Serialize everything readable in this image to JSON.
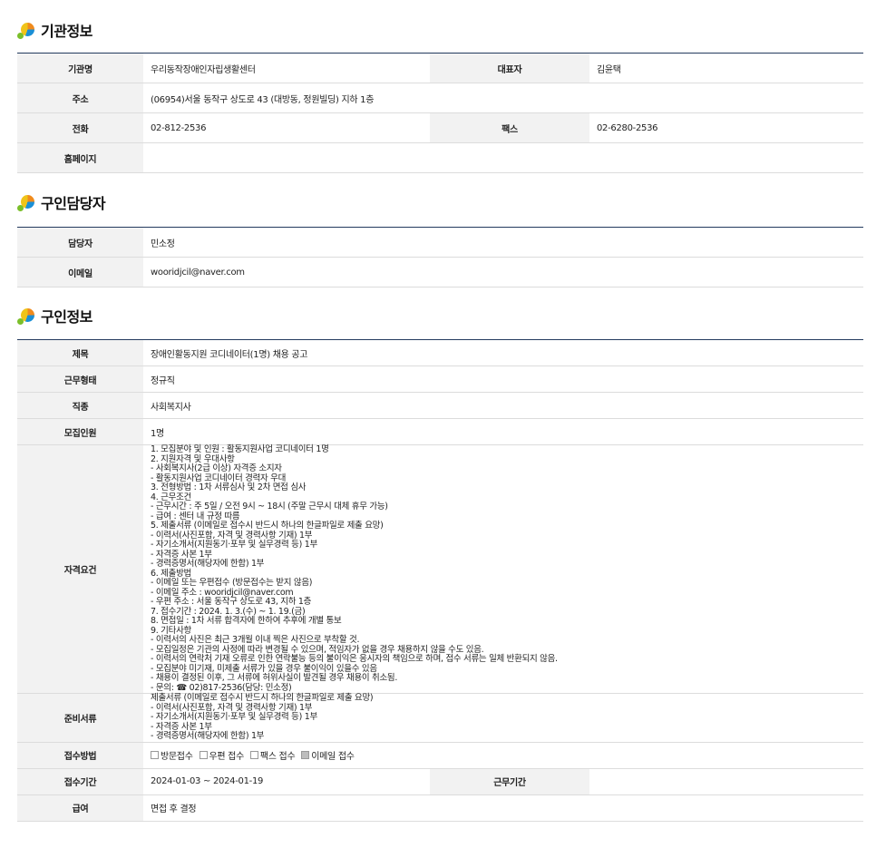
{
  "sections": {
    "org": "기관정보",
    "contact": "구인담당자",
    "job": "구인정보"
  },
  "org": {
    "name_label": "기관명",
    "name": "우리동작장애인자립생활센터",
    "rep_label": "대표자",
    "rep": "김윤택",
    "addr_label": "주소",
    "addr": "(06954)서울 동작구 상도로 43 (대방동, 정원빌딩) 지하 1층",
    "tel_label": "전화",
    "tel": "02-812-2536",
    "fax_label": "팩스",
    "fax": "02-6280-2536",
    "home_label": "홈페이지",
    "home": ""
  },
  "contact": {
    "person_label": "담당자",
    "person": "민소정",
    "email_label": "이메일",
    "email": "wooridjcil@naver.com"
  },
  "job": {
    "title_label": "제목",
    "title": "장애인활동지원 코디네이터(1명) 채용 공고",
    "type_label": "근무형태",
    "type": "정규직",
    "kind_label": "직종",
    "kind": "사회복지사",
    "count_label": "모집인원",
    "count": "1명",
    "qual_label": "자격요건",
    "qual": "1. 모집분야 및 인원 : 활동지원사업 코디네이터 1명\n2. 지원자격 및 우대사항\n- 사회복지사(2급 이상) 자격증 소지자\n- 활동지원사업 코디네이터 경력자 우대\n3. 전형방법 : 1차 서류심사 및 2차 면접 심사\n4. 근무조건\n - 근무시간 : 주 5일 / 오전 9시 ~ 18시 (주말 근무시 대체 휴무 가능)\n - 급여 : 센터 내 규정 따름\n5. 제출서류 (이메일로 접수시 반드시 하나의 한글파일로 제출 요망)\n- 이력서(사진포함, 자격 및 경력사항 기재) 1부\n- 자기소개서(지원동기·포부 및 실무경력 등) 1부\n- 자격증 사본 1부\n- 경력증명서(해당자에 한함) 1부\n6. 제출방법\n- 이메일 또는 우편접수 (방문접수는 받지 않음)\n- 이메일 주소 : wooridjcil@naver.com\n- 우편 주소 : 서울 동작구 상도로 43, 지하 1층\n7. 접수기간 : 2024. 1. 3.(수) ~ 1. 19.(금)\n8. 면접일 : 1차 서류 합격자에 한하여 추후에 개별 통보\n9. 기타사항\n- 이력서의 사진은 최근 3개월 이내 찍은 사진으로 부착할 것.\n- 모집일정은 기관의 사정에 따라 변경될 수 있으며, 적임자가 없을 경우 채용하지 않을 수도 있음.\n- 이력서의 연락처 기재 오류로 인한 연락불능 등의 불이익은 응시자의 책임으로 하며, 접수 서류는 일체 반환되지 않음.\n- 모집분야 미기재, 미제출 서류가 있을 경우 불이익이 있을수 있음\n- 채용이 결정된 이후, 그 서류에 허위사실이 발견될 경우 채용이 취소됨.\n - 문의: ☎ 02)817-2536(담당: 민소정)",
    "docs_label": "준비서류",
    "docs": "제출서류 (이메일로 접수시 반드시 하나의 한글파일로 제출 요망)\n- 이력서(사진포함, 자격 및 경력사항 기재) 1부\n- 자기소개서(지원동기·포부 및 실무경력 등) 1부\n- 자격증 사본 1부\n- 경력증명서(해당자에 한함) 1부",
    "method_label": "접수방법",
    "methods": [
      {
        "label": "방문접수",
        "checked": false
      },
      {
        "label": "우편 접수",
        "checked": false
      },
      {
        "label": "팩스 접수",
        "checked": false
      },
      {
        "label": "이메일 접수",
        "checked": true
      }
    ],
    "period_label": "접수기간",
    "period": "2024-01-03 ~ 2024-01-19",
    "work_period_label": "근무기간",
    "work_period": "",
    "pay_label": "급여",
    "pay": "면접 후 결정"
  },
  "colors": {
    "table_top_border": "#233a5e",
    "header_bg": "#f2f2f2",
    "row_border": "#dcdcdc"
  }
}
